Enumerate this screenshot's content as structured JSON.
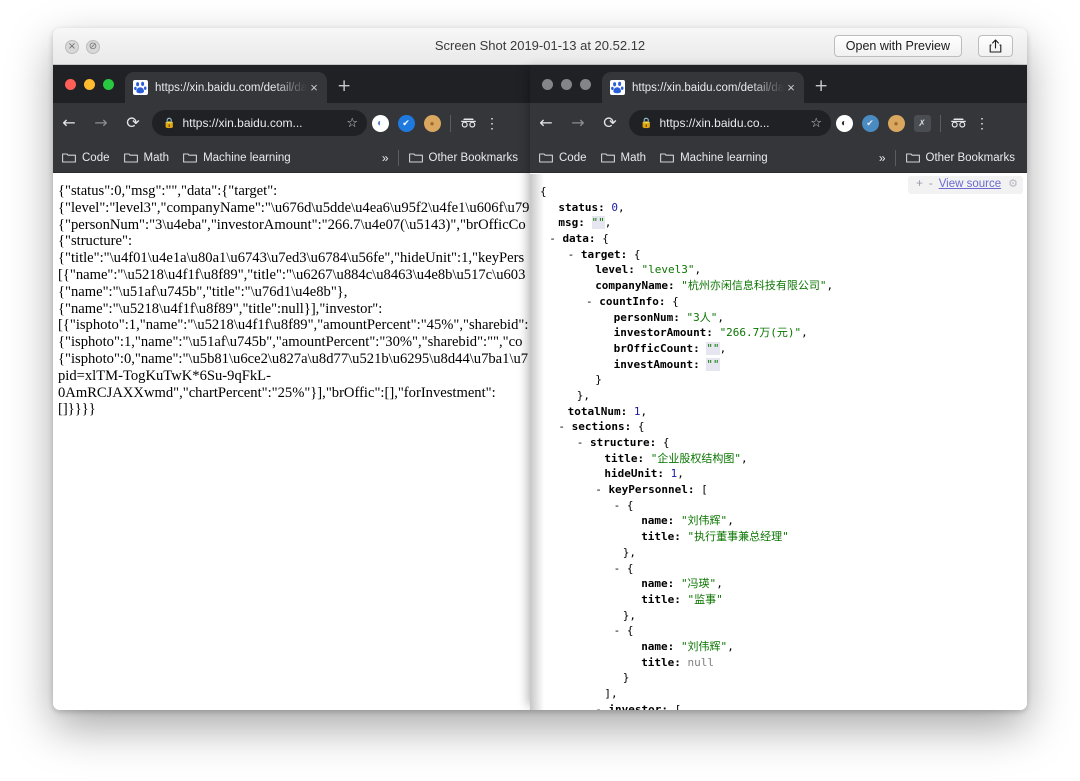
{
  "quicklook": {
    "title": "Screen Shot 2019-01-13 at 20.52.12",
    "open_button_label": "Open with Preview",
    "close_glyph": "×",
    "minimize_glyph": "⊘",
    "share_icon_name": "share-icon"
  },
  "browser_left": {
    "window_state": "active",
    "tab": {
      "title": "https://xin.baidu.com/detail/da",
      "close_glyph": "×",
      "favicon_name": "baidu-favicon"
    },
    "new_tab_glyph": "+",
    "toolbar": {
      "back_glyph": "←",
      "forward_glyph": "→",
      "reload_glyph": "⟳",
      "lock_glyph": "🔒",
      "url": "https://xin.baidu.com...",
      "star_glyph": "☆",
      "extensions": [
        {
          "name": "adblock-extension-icon",
          "color": "#ffffff",
          "glyph": "◐",
          "glyph_color": "#4a7fc1"
        },
        {
          "name": "pocket-extension-icon",
          "color": "#1f7ae0",
          "glyph": "✔",
          "glyph_color": "#ffffff"
        },
        {
          "name": "cookie-extension-icon",
          "color": "#d4a14a",
          "glyph": "●",
          "glyph_color": "#a8762b"
        }
      ],
      "incognito_glyph": "☉☉",
      "menu_glyph": "⋮"
    },
    "bookmarks": [
      {
        "label": "Code"
      },
      {
        "label": "Math"
      },
      {
        "label": "Machine learning"
      }
    ],
    "bookmarks_overflow_glyph": "»",
    "other_bookmarks_label": "Other Bookmarks",
    "page_text": "{\"status\":0,\"msg\":\"\",\"data\":{\"target\":\n{\"level\":\"level3\",\"companyName\":\"\\u676d\\u5dde\\u4ea6\\u95f2\\u4fe1\\u606f\\u79\n{\"personNum\":\"3\\u4eba\",\"investorAmount\":\"266.7\\u4e07(\\u5143)\",\"brOfficCo\n{\"structure\":\n{\"title\":\"\\u4f01\\u4e1a\\u80a1\\u6743\\u7ed3\\u6784\\u56fe\",\"hideUnit\":1,\"keyPers\n[{\"name\":\"\\u5218\\u4f1f\\u8f89\",\"title\":\"\\u6267\\u884c\\u8463\\u4e8b\\u517c\\u603\n{\"name\":\"\\u51af\\u745b\",\"title\":\"\\u76d1\\u4e8b\"},\n{\"name\":\"\\u5218\\u4f1f\\u8f89\",\"title\":null}],\"investor\":\n[{\"isphoto\":1,\"name\":\"\\u5218\\u4f1f\\u8f89\",\"amountPercent\":\"45%\",\"sharebid\":\n{\"isphoto\":1,\"name\":\"\\u51af\\u745b\",\"amountPercent\":\"30%\",\"sharebid\":\"\",\"co\n{\"isphoto\":0,\"name\":\"\\u5b81\\u6ce2\\u827a\\u8d77\\u521b\\u6295\\u8d44\\u7ba1\\u7\npid=xlTM-TogKuTwK*6Su-9qFkL-\n0AmRCJAXXwmd\",\"chartPercent\":\"25%\"}],\"brOffic\":[],\"forInvestment\":\n[]}}}}"
  },
  "browser_right": {
    "window_state": "inactive",
    "tab": {
      "title": "https://xin.baidu.com/detail/da",
      "close_glyph": "×",
      "favicon_name": "baidu-favicon"
    },
    "new_tab_glyph": "+",
    "toolbar": {
      "back_glyph": "←",
      "forward_glyph": "→",
      "reload_glyph": "⟳",
      "lock_glyph": "🔒",
      "url": "https://xin.baidu.co...",
      "star_glyph": "☆",
      "extensions": [
        {
          "name": "adblock-extension-icon",
          "color": "#ffffff",
          "glyph": "◐",
          "glyph_color": "#3b3b3b"
        },
        {
          "name": "pocket-extension-icon",
          "color": "#4a8bc2",
          "glyph": "✔",
          "glyph_color": "#e8eaed"
        },
        {
          "name": "cookie-extension-icon",
          "color": "#d4a14a",
          "glyph": "●",
          "glyph_color": "#a8762b"
        },
        {
          "name": "jsonview-extension-icon",
          "color": "#4a4d51",
          "glyph": "✗",
          "glyph_color": "#d4d6d9"
        }
      ],
      "incognito_glyph": "☉☉",
      "menu_glyph": "⋮"
    },
    "bookmarks": [
      {
        "label": "Code"
      },
      {
        "label": "Math"
      },
      {
        "label": "Machine learning"
      }
    ],
    "bookmarks_overflow_glyph": "»",
    "other_bookmarks_label": "Other Bookmarks",
    "viewer_toolbar": {
      "expand_label": "+",
      "collapse_label": "-",
      "view_source_label": "View source",
      "gear_glyph": "⚙"
    },
    "json_lines": [
      {
        "indent": 0,
        "toggle": "",
        "text": "{",
        "cls": "jpunct"
      },
      {
        "indent": 2,
        "toggle": "",
        "key": "status",
        "value": "0",
        "vcls": "jnum",
        "suffix": ","
      },
      {
        "indent": 2,
        "toggle": "",
        "key": "msg",
        "value": "\"\"",
        "vcls": "jempty",
        "suffix": ","
      },
      {
        "indent": 1,
        "toggle": "-",
        "key": "data",
        "value": "{",
        "vcls": "jpunct",
        "suffix": ""
      },
      {
        "indent": 3,
        "toggle": "-",
        "key": "target",
        "value": "{",
        "vcls": "jpunct",
        "suffix": ""
      },
      {
        "indent": 6,
        "toggle": "",
        "key": "level",
        "value": "\"level3\"",
        "vcls": "jstr",
        "suffix": ","
      },
      {
        "indent": 6,
        "toggle": "",
        "key": "companyName",
        "value": "\"杭州亦闲信息科技有限公司\"",
        "vcls": "jstr",
        "suffix": ","
      },
      {
        "indent": 5,
        "toggle": "-",
        "key": "countInfo",
        "value": "{",
        "vcls": "jpunct",
        "suffix": ""
      },
      {
        "indent": 8,
        "toggle": "",
        "key": "personNum",
        "value": "\"3人\"",
        "vcls": "jstr",
        "suffix": ","
      },
      {
        "indent": 8,
        "toggle": "",
        "key": "investorAmount",
        "value": "\"266.7万(元)\"",
        "vcls": "jstr",
        "suffix": ","
      },
      {
        "indent": 8,
        "toggle": "",
        "key": "brOfficCount",
        "value": "\"\"",
        "vcls": "jempty",
        "suffix": ","
      },
      {
        "indent": 8,
        "toggle": "",
        "key": "investAmount",
        "value": "\"\"",
        "vcls": "jempty",
        "suffix": ""
      },
      {
        "indent": 6,
        "toggle": "",
        "text": "}",
        "cls": "jpunct"
      },
      {
        "indent": 4,
        "toggle": "",
        "text": "},",
        "cls": "jpunct"
      },
      {
        "indent": 3,
        "toggle": "",
        "key": "totalNum",
        "value": "1",
        "vcls": "jnum",
        "suffix": ","
      },
      {
        "indent": 2,
        "toggle": "-",
        "key": "sections",
        "value": "{",
        "vcls": "jpunct",
        "suffix": ""
      },
      {
        "indent": 4,
        "toggle": "-",
        "key": "structure",
        "value": "{",
        "vcls": "jpunct",
        "suffix": ""
      },
      {
        "indent": 7,
        "toggle": "",
        "key": "title",
        "value": "\"企业股权结构图\"",
        "vcls": "jstr",
        "suffix": ","
      },
      {
        "indent": 7,
        "toggle": "",
        "key": "hideUnit",
        "value": "1",
        "vcls": "jnum",
        "suffix": ","
      },
      {
        "indent": 6,
        "toggle": "-",
        "key": "keyPersonnel",
        "value": "[",
        "vcls": "jpunct",
        "suffix": ""
      },
      {
        "indent": 8,
        "toggle": "-",
        "text": "{",
        "cls": "jpunct"
      },
      {
        "indent": 11,
        "toggle": "",
        "key": "name",
        "value": "\"刘伟辉\"",
        "vcls": "jstr",
        "suffix": ","
      },
      {
        "indent": 11,
        "toggle": "",
        "key": "title",
        "value": "\"执行董事兼总经理\"",
        "vcls": "jstr",
        "suffix": ""
      },
      {
        "indent": 9,
        "toggle": "",
        "text": "},",
        "cls": "jpunct"
      },
      {
        "indent": 8,
        "toggle": "-",
        "text": "{",
        "cls": "jpunct"
      },
      {
        "indent": 11,
        "toggle": "",
        "key": "name",
        "value": "\"冯瑛\"",
        "vcls": "jstr",
        "suffix": ","
      },
      {
        "indent": 11,
        "toggle": "",
        "key": "title",
        "value": "\"监事\"",
        "vcls": "jstr",
        "suffix": ""
      },
      {
        "indent": 9,
        "toggle": "",
        "text": "},",
        "cls": "jpunct"
      },
      {
        "indent": 8,
        "toggle": "-",
        "text": "{",
        "cls": "jpunct"
      },
      {
        "indent": 11,
        "toggle": "",
        "key": "name",
        "value": "\"刘伟辉\"",
        "vcls": "jstr",
        "suffix": ","
      },
      {
        "indent": 11,
        "toggle": "",
        "key": "title",
        "value": "null",
        "vcls": "jnull",
        "suffix": ""
      },
      {
        "indent": 9,
        "toggle": "",
        "text": "}",
        "cls": "jpunct"
      },
      {
        "indent": 7,
        "toggle": "",
        "text": "],",
        "cls": "jpunct"
      },
      {
        "indent": 6,
        "toggle": "-",
        "key": "investor",
        "value": "[",
        "vcls": "jpunct",
        "suffix": ""
      }
    ]
  }
}
